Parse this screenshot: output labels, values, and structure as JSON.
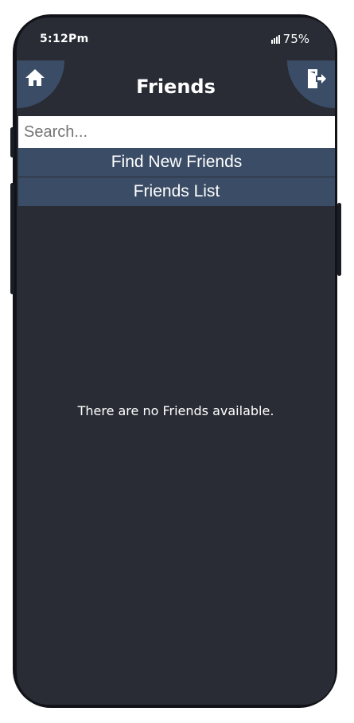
{
  "status_bar": {
    "time": "5:12Pm",
    "battery": "75%"
  },
  "header": {
    "title": "Friends",
    "left_icon": "home-icon",
    "right_icon": "logout-icon"
  },
  "search": {
    "placeholder": "Search...",
    "value": ""
  },
  "nav": {
    "find_new_friends": "Find New Friends",
    "friends_list": "Friends List"
  },
  "main": {
    "empty_message": "There are no Friends available."
  },
  "colors": {
    "background": "#292c35",
    "accent": "#3b4d66",
    "text": "#ffffff"
  }
}
